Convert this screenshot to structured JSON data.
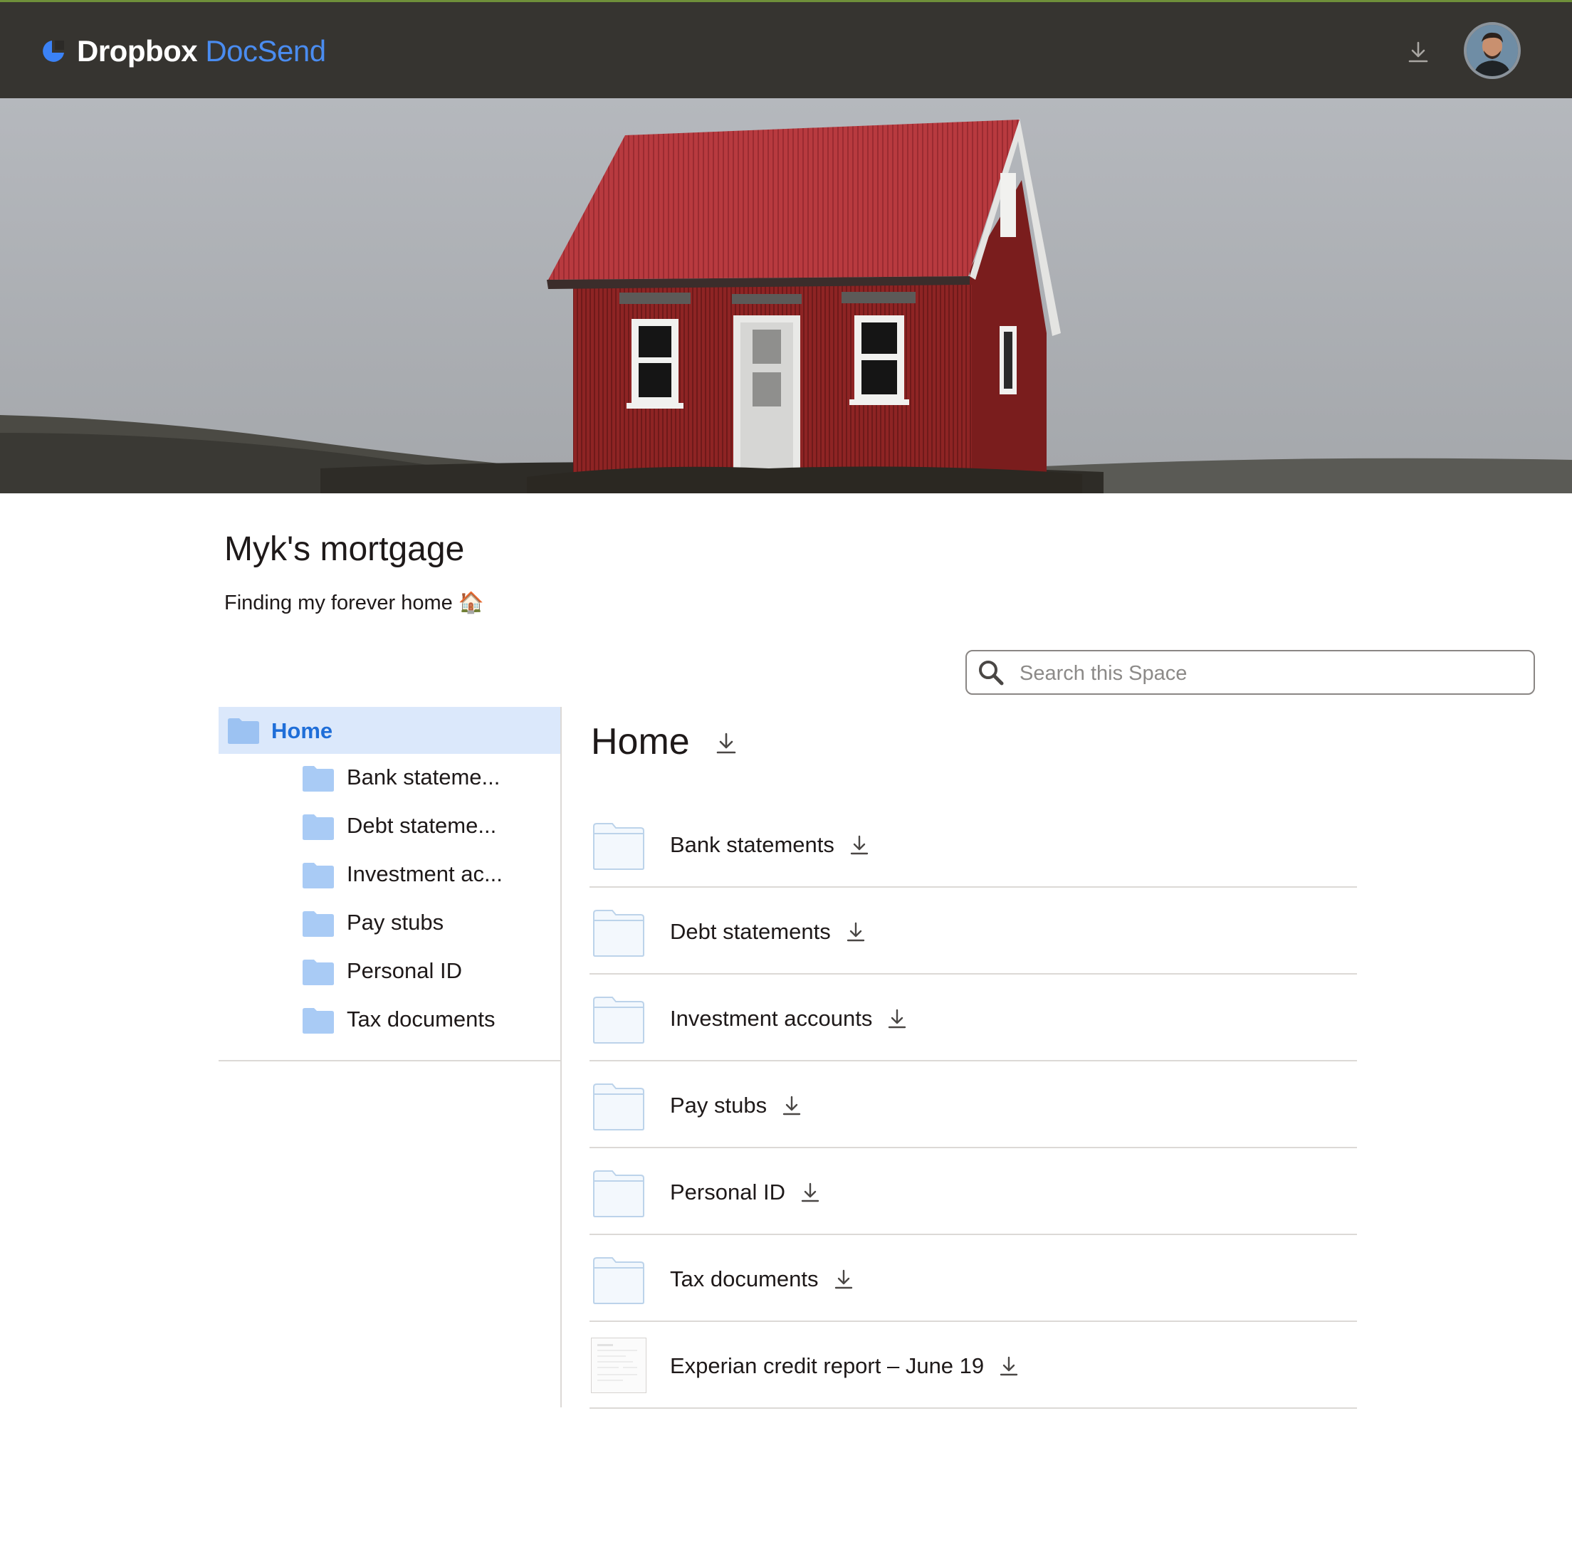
{
  "header": {
    "brand_primary": "Dropbox",
    "brand_secondary": "DocSend",
    "download_icon": "download-icon",
    "avatar_icon": "user-avatar"
  },
  "hero": {
    "image": "red-corrugated-house-photo"
  },
  "space": {
    "title": "Myk's mortgage",
    "subtitle": "Finding my forever home 🏠"
  },
  "search": {
    "placeholder": "Search this Space",
    "value": ""
  },
  "sidebar": {
    "home_label": "Home",
    "items": [
      {
        "label": "Bank stateme..."
      },
      {
        "label": "Debt stateme..."
      },
      {
        "label": "Investment ac..."
      },
      {
        "label": "Pay stubs"
      },
      {
        "label": "Personal ID"
      },
      {
        "label": "Tax documents"
      }
    ]
  },
  "main": {
    "heading": "Home",
    "rows": [
      {
        "label": "Bank statements",
        "kind": "folder"
      },
      {
        "label": "Debt statements",
        "kind": "folder"
      },
      {
        "label": "Investment accounts",
        "kind": "folder"
      },
      {
        "label": "Pay stubs",
        "kind": "folder"
      },
      {
        "label": "Personal ID",
        "kind": "folder"
      },
      {
        "label": "Tax documents",
        "kind": "folder"
      },
      {
        "label": "Experian credit report – June 19",
        "kind": "document"
      }
    ]
  },
  "colors": {
    "topbar": "#363430",
    "accent_blue": "#1f6ed8",
    "brand_blue": "#4a8cf0",
    "selected_bg": "#dbe8fb",
    "folder_blue": "#a9cbf5"
  }
}
